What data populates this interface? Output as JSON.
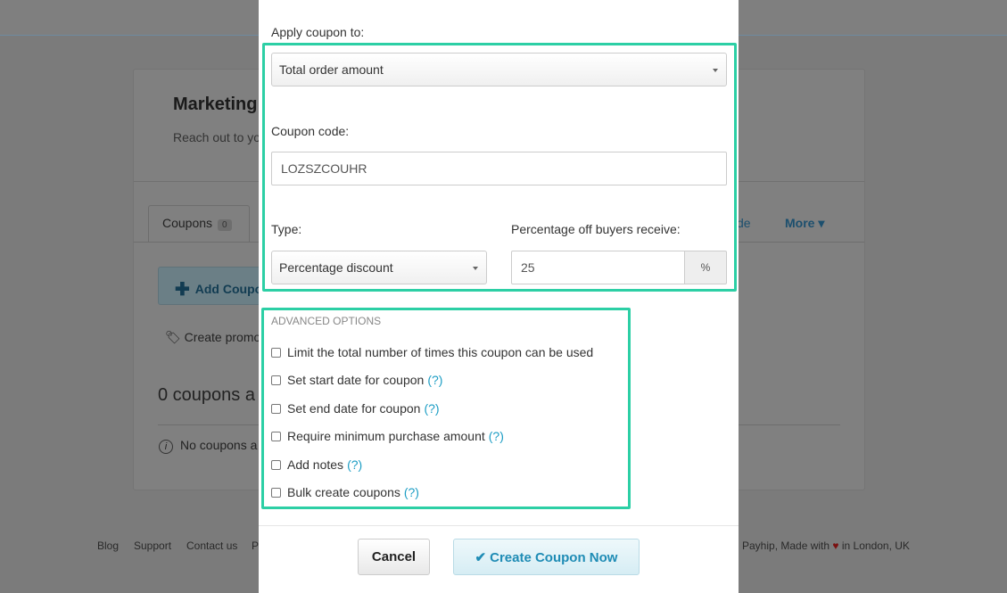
{
  "background": {
    "title": "Marketing",
    "subtitle": "Reach out to yo",
    "tab_coupons": "Coupons",
    "tab_coupons_count": "0",
    "tab_partial": "de",
    "tab_more": "More ▾",
    "add_coupon": "Add Coupo",
    "create_promo": "Create promo",
    "coupon_count": "0 coupons a",
    "no_coupons": "No coupons a",
    "footer_links": [
      "Blog",
      "Support",
      "Contact us",
      "P"
    ],
    "footer_right_prefix": "Payhip, Made with",
    "footer_right_suffix": "in London, UK"
  },
  "modal": {
    "apply_label": "Apply coupon to:",
    "apply_value": "Total order amount",
    "code_label": "Coupon code:",
    "code_value": "LOZSZCOUHR",
    "type_label": "Type:",
    "type_value": "Percentage discount",
    "percent_label": "Percentage off buyers receive:",
    "percent_value": "25",
    "percent_addon": "%",
    "advanced_title": "ADVANCED OPTIONS",
    "options": [
      {
        "label": "Limit the total number of times this coupon can be used",
        "help": ""
      },
      {
        "label": "Set start date for coupon",
        "help": "(?)"
      },
      {
        "label": "Set end date for coupon",
        "help": "(?)"
      },
      {
        "label": "Require minimum purchase amount",
        "help": "(?)"
      },
      {
        "label": "Add notes",
        "help": "(?)"
      },
      {
        "label": "Bulk create coupons",
        "help": "(?)"
      }
    ],
    "cancel_label": "Cancel",
    "create_label": "Create Coupon Now"
  },
  "colors": {
    "highlight": "#2ccfa5",
    "link": "#1c9dc4",
    "overlay": "#7b7b7b"
  }
}
